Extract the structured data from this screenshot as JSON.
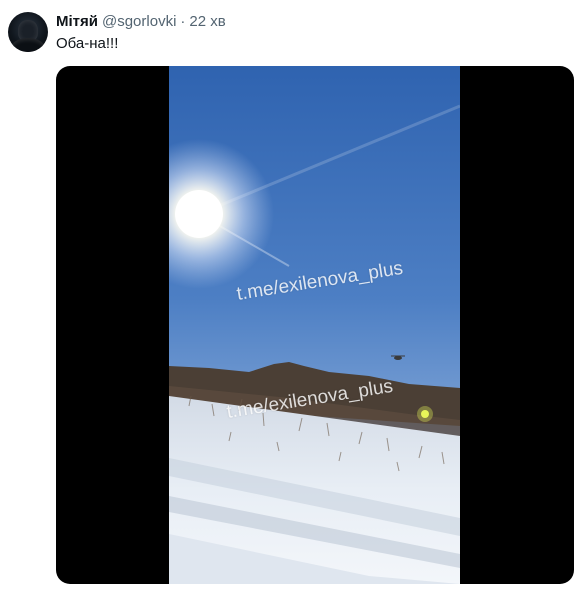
{
  "tweet": {
    "author_name": "Мітяй",
    "handle": "@sgorlovki",
    "separator": "·",
    "time": "22 хв",
    "text": "Оба-на!!!"
  },
  "media": {
    "watermark_1": "t.me/exilenova_plus",
    "watermark_2": "t.me/exilenova_plus"
  },
  "colors": {
    "name_text": "#0f1419",
    "secondary_text": "#536471",
    "media_background": "#000000",
    "sky_top": "#3f6fb6",
    "sky_bottom": "#9fb9df",
    "snow": "#e8eef5",
    "treeline": "#4a3f36"
  },
  "icons": {
    "avatar": "avatar-silhouette"
  }
}
